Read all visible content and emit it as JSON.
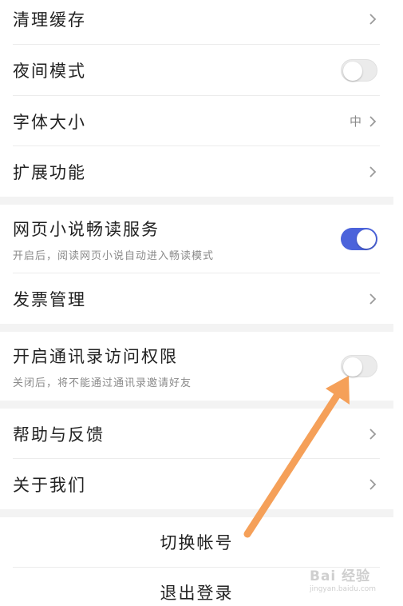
{
  "settings": {
    "clear_cache": {
      "label": "清理缓存"
    },
    "night_mode": {
      "label": "夜间模式",
      "enabled": false
    },
    "font_size": {
      "label": "字体大小",
      "value": "中"
    },
    "extensions": {
      "label": "扩展功能"
    },
    "novel_reading": {
      "label": "网页小说畅读服务",
      "description": "开启后，阅读网页小说自动进入畅读模式",
      "enabled": true
    },
    "invoice": {
      "label": "发票管理"
    },
    "contacts_access": {
      "label": "开启通讯录访问权限",
      "description": "关闭后，将不能通过通讯录邀请好友",
      "enabled": false
    },
    "help_feedback": {
      "label": "帮助与反馈"
    },
    "about": {
      "label": "关于我们"
    }
  },
  "account": {
    "switch_label": "切换帐号",
    "logout_label": "退出登录"
  },
  "watermark": {
    "main": "Bai 经验",
    "sub": "jingyan.baidu.com"
  },
  "colors": {
    "accent": "#4b63db",
    "annotation_arrow": "#f5a059",
    "background_gap": "#f3f3f3"
  },
  "icons": {
    "chevron": "chevron-right-icon",
    "toggle": "toggle-switch",
    "annotation": "arrow-annotation-icon"
  }
}
